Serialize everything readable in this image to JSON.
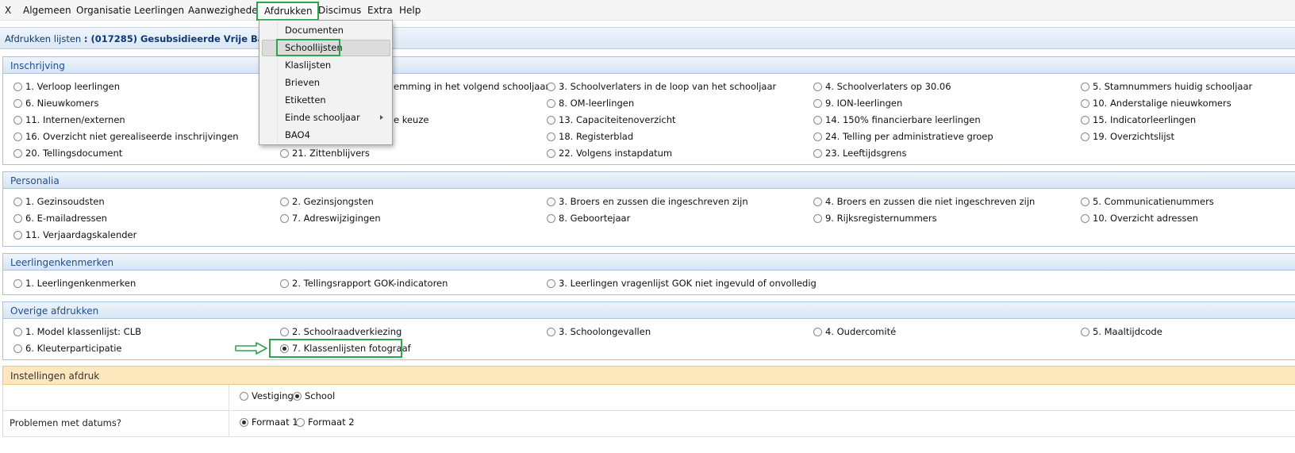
{
  "menubar": {
    "items": [
      "X",
      "Algemeen",
      "Organisatie",
      "Leerlingen",
      "Aanwezigheden",
      "Afdrukken",
      "Discimus",
      "Extra",
      "Help"
    ],
    "active": "Afdrukken"
  },
  "page": {
    "title_prefix": "Afdrukken lijsten",
    "title_school": ": (017285) Gesubsidieerde Vrije Basisschool"
  },
  "dropdown": {
    "items": [
      "Documenten",
      "Schoollijsten",
      "Klaslijsten",
      "Brieven",
      "Etiketten",
      "Einde schooljaar",
      "BAO4"
    ],
    "highlighted": "Schoollijsten",
    "submenu_item": "Einde schooljaar"
  },
  "sections": {
    "inschrijving": {
      "title": "Inschrijving",
      "options": [
        "1. Verloop leerlingen",
        "emming in het volgend schooljaar",
        "3. Schoolverlaters in de loop van het schooljaar",
        "4. Schoolverlaters op 30.06",
        "5. Stamnummers huidig schooljaar",
        "6. Nieuwkomers",
        "8. OM-leerlingen",
        "9. ION-leerlingen",
        "10. Anderstalige nieuwkomers",
        "11. Internen/externen",
        "e keuze",
        "13. Capaciteitenoverzicht",
        "14. 150% financierbare leerlingen",
        "15. Indicatorleerlingen",
        "16. Overzicht niet gerealiseerde inschrijvingen",
        "18. Registerblad",
        "24. Telling per administratieve groep",
        "19. Overzichtslijst",
        "20. Tellingsdocument",
        "21. Zittenblijvers",
        "22. Volgens instapdatum",
        "23. Leeftijdsgrens"
      ]
    },
    "personalia": {
      "title": "Personalia",
      "options": [
        "1. Gezinsoudsten",
        "2. Gezinsjongsten",
        "3. Broers en zussen die ingeschreven zijn",
        "4. Broers en zussen die niet ingeschreven zijn",
        "5. Communicatienummers",
        "6. E-mailadressen",
        "7. Adreswijzigingen",
        "8. Geboortejaar",
        "9. Rijksregisternummers",
        "10. Overzicht adressen",
        "11. Verjaardagskalender"
      ]
    },
    "leerlingenkenmerken": {
      "title": "Leerlingenkenmerken",
      "options": [
        "1. Leerlingenkenmerken",
        "2. Tellingsrapport GOK-indicatoren",
        "3. Leerlingen vragenlijst GOK niet ingevuld of onvolledig"
      ]
    },
    "overige": {
      "title": "Overige afdrukken",
      "options": [
        "1. Model klassenlijst: CLB",
        "2. Schoolraadverkiezing",
        "3. Schoolongevallen",
        "4. Oudercomité",
        "5. Maaltijdcode",
        "6. Kleuterparticipatie",
        "7. Klassenlijsten fotograaf"
      ],
      "selected": "7. Klassenlijsten fotograaf"
    }
  },
  "settings": {
    "title": "Instellingen afdruk",
    "row1": {
      "label": "",
      "options": [
        "Vestiging",
        "School"
      ],
      "selected": "School"
    },
    "row2": {
      "label": "Problemen met datums?",
      "options": [
        "Formaat 1",
        "Formaat 2"
      ],
      "selected": "Formaat 1"
    }
  },
  "colors": {
    "highlight": "#2ea44f",
    "section_header": "#d7e5f3",
    "settings_header": "#fde8be"
  }
}
